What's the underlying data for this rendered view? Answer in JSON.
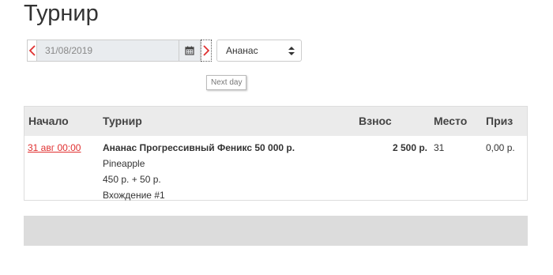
{
  "page": {
    "title": "Турнир"
  },
  "filters": {
    "date_value": "31/08/2019",
    "select_value": "Ананас",
    "tooltip": "Next day"
  },
  "icons": {
    "prev": "chevron-left-icon",
    "next": "chevron-right-icon",
    "calendar": "calendar-icon",
    "select": "sort-caret-icon"
  },
  "colors": {
    "accent": "#e03030",
    "header_bg": "#ebebeb"
  },
  "table": {
    "headers": {
      "start": "Начало",
      "tournament": "Турнир",
      "fee": "Взнос",
      "place": "Место",
      "prize": "Приз"
    },
    "rows": [
      {
        "start": "31 авг 00:00",
        "tournament_name": "Ананас Прогрессивный Феникс 50 000 р.",
        "room": "Pineapple",
        "buyin": "450 р. + 50 р.",
        "entry": "Вхождение #1",
        "fee": "2 500 р.",
        "place": "31",
        "prize": "0,00 р."
      }
    ]
  }
}
